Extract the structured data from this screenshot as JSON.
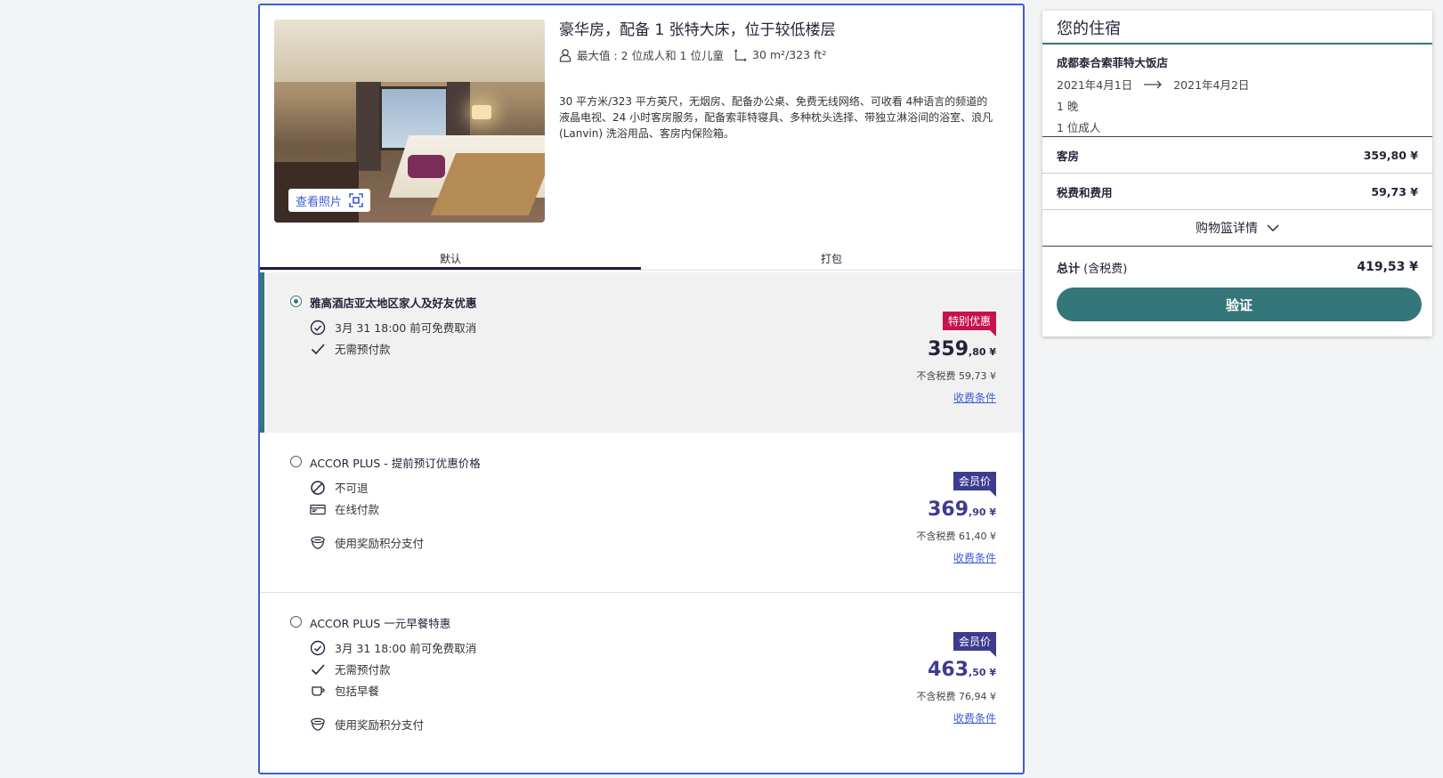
{
  "room": {
    "photo_button": "查看照片",
    "title": "豪华房，配备 1 张特大床，位于较低楼层",
    "capacity": "最大值 : 2 位成人和 1 位儿童",
    "size": "30 m²/323 ft²",
    "description": "30 平方米/323 平方英尺，无烟房、配备办公桌、免费无线网络、可收看 4种语言的频道的液晶电视、24 小时客房服务，配备索菲特寝具、多种枕头选择、带独立淋浴间的浴室、浪凡 (Lanvin) 洗浴用品、客房内保险箱。"
  },
  "tabs": [
    {
      "label": "默认"
    },
    {
      "label": "打包"
    }
  ],
  "offers": [
    {
      "name": "雅高酒店亚太地区家人及好友优惠",
      "features": [
        "3月 31 18:00 前可免费取消",
        "无需预付款"
      ],
      "badge": "特别优惠",
      "price_int": "359",
      "price_dec": ",80 ¥",
      "tax": "不含税费 59,73 ¥",
      "terms": "收费条件"
    },
    {
      "name": "ACCOR PLUS - 提前预订优惠价格",
      "features": [
        "不可退",
        "在线付款",
        "使用奖励积分支付"
      ],
      "badge": "会员价",
      "price_int": "369",
      "price_dec": ",90 ¥",
      "tax": "不含税费 61,40 ¥",
      "terms": "收费条件"
    },
    {
      "name": "ACCOR PLUS 一元早餐特惠",
      "features": [
        "3月 31 18:00 前可免费取消",
        "无需预付款",
        "包括早餐",
        "使用奖励积分支付"
      ],
      "badge": "会员价",
      "price_int": "463",
      "price_dec": ",50 ¥",
      "tax": "不含税费 76,94 ¥",
      "terms": "收费条件"
    }
  ],
  "summary": {
    "title": "您的住宿",
    "hotel": "成都泰合索菲特大饭店",
    "checkin": "2021年4月1日",
    "checkout": "2021年4月2日",
    "nights": "1 晚",
    "guests": "1 位成人",
    "room_label": "客房",
    "room_amount": "359,80 ¥",
    "tax_label": "税费和费用",
    "tax_amount": "59,73 ¥",
    "cart_details": "购物篮详情",
    "total_label": "总计",
    "total_suffix": " (含税费)",
    "total_amount": "419,53 ¥",
    "verify_button": "验证"
  },
  "colors": {
    "accent_teal": "#35767b",
    "card_border": "#3b5dd6",
    "special_badge": "#c8104d",
    "member_badge": "#3d3c8f"
  }
}
